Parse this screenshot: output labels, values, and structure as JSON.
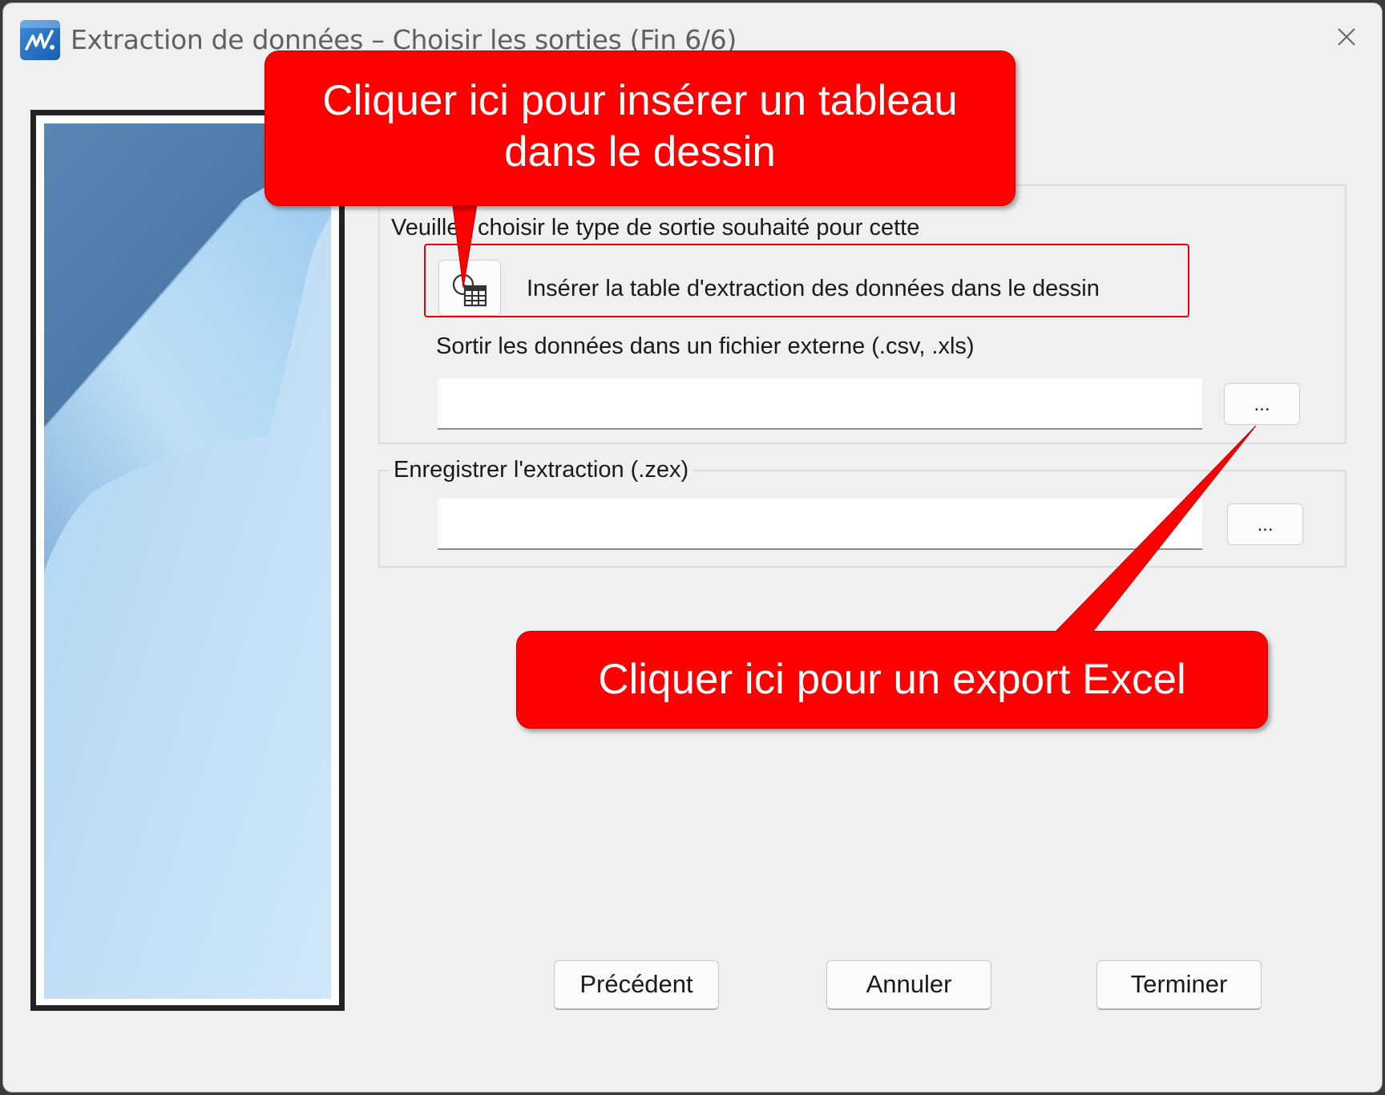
{
  "window": {
    "title": "Extraction de données – Choisir les sorties (Fin 6/6)"
  },
  "output_group": {
    "prompt": "Veuillez choisir le type de sortie souhaité pour cette",
    "insert_table_label": "Insérer la table d'extraction des données dans le dessin",
    "external_file_label": "Sortir les données dans un fichier externe (.csv, .xls)",
    "external_file_value": "",
    "browse_label": "..."
  },
  "save_group": {
    "legend": "Enregistrer l'extraction (.zex)",
    "file_value": "",
    "browse_label": "..."
  },
  "buttons": {
    "previous": "Précédent",
    "cancel": "Annuler",
    "finish": "Terminer"
  },
  "callouts": {
    "insert_table": [
      "Cliquer ici pour insérer un tableau",
      "dans le dessin"
    ],
    "excel_export": "Cliquer ici pour un export Excel"
  },
  "colors": {
    "callout": "#fe0000",
    "highlight": "#e8000a",
    "side_panel_dark": "#4a76a4",
    "side_panel_light": "#c3e0f5"
  },
  "icons": [
    "app-icon",
    "close-icon",
    "table-insert-icon"
  ]
}
